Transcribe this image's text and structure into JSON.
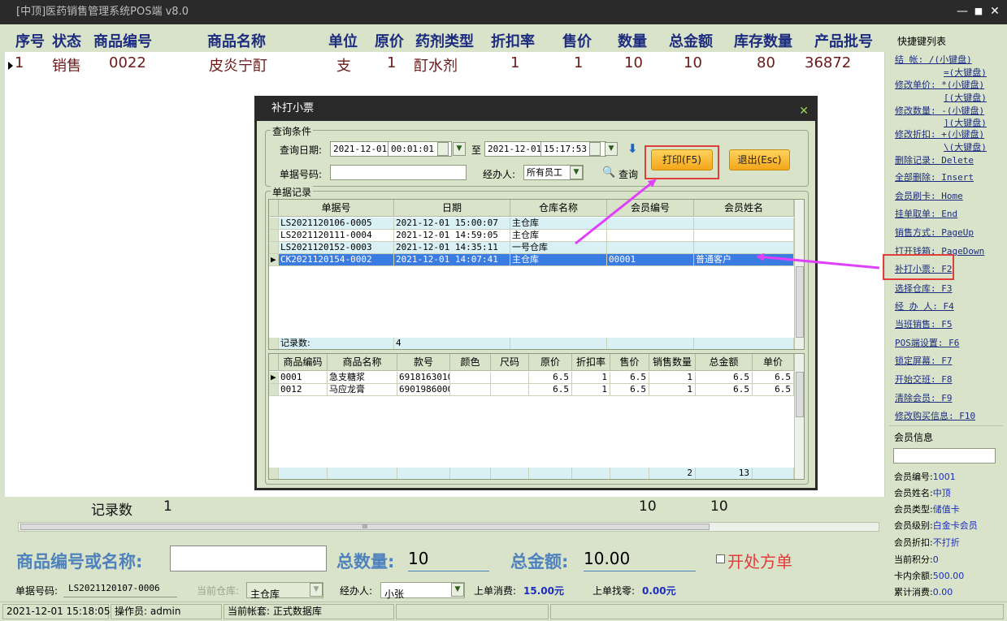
{
  "window": {
    "title": "[中顶]医药销售管理系统POS端 v8.0",
    "min": "—",
    "max": "■",
    "close": "✕"
  },
  "grid": {
    "columns": [
      "序号",
      "状态",
      "商品编号",
      "商品名称",
      "单位",
      "原价",
      "药剂类型",
      "折扣率",
      "售价",
      "数量",
      "总金额",
      "库存数量",
      "产品批号"
    ],
    "rows": [
      {
        "seq": "1",
        "status": "销售",
        "code": "0022",
        "name": "皮炎宁酊",
        "unit": "支",
        "price": "1",
        "type": "酊水剂",
        "discount": "1",
        "sale": "1",
        "qty": "10",
        "total": "10",
        "stock": "80",
        "batch": "36872"
      }
    ],
    "summary": {
      "label": "记录数",
      "count": "1",
      "qty": "10",
      "total": "10"
    },
    "scroll_grip": "III"
  },
  "input_bar": {
    "product_label": "商品编号或名称:",
    "product_value": "",
    "qty_label": "总数量:",
    "qty_value": "10",
    "amount_label": "总金额:",
    "amount_value": "10.00",
    "prescription_label": "开处方单"
  },
  "info_bar": {
    "order_no_label": "单据号码:",
    "order_no": "LS2021120107-0006",
    "warehouse_label": "当前仓库:",
    "warehouse": "主仓库",
    "operator_label": "经办人:",
    "operator": "小张",
    "last_spend_label": "上单消费:",
    "last_spend": "15.00元",
    "last_change_label": "上单找零:",
    "last_change": "0.00元"
  },
  "status_bar": {
    "datetime": "2021-12-01 15:18:05",
    "operator": "操作员: admin",
    "account": "当前帐套: 正式数据库"
  },
  "shortcuts": {
    "title": "快捷键列表",
    "items": [
      "结  帐: /(小键盘)",
      "=(大键盘)",
      "修改单价: *(小键盘)",
      "[(大键盘)",
      "修改数量: -(小键盘)",
      "](大键盘)",
      "修改折扣: +(小键盘)",
      "\\(大键盘)",
      "删除记录: Delete",
      "全部删除: Insert",
      "会员刷卡: Home",
      "挂单取单: End",
      "销售方式: PageUp",
      "打开钱箱: PageDown",
      "补打小票: F2",
      "选择仓库: F3",
      "经 办 人: F4",
      "当班销售: F5",
      "POS端设置: F6",
      "锁定屏幕: F7",
      "开始交班: F8",
      "清除会员: F9",
      "修改购买信息: F10"
    ]
  },
  "member": {
    "title": "会员信息",
    "search": "",
    "fields": [
      {
        "label": "会员编号:",
        "value": "1001"
      },
      {
        "label": "会员姓名:",
        "value": "中顶"
      },
      {
        "label": "会员类型:",
        "value": "储值卡"
      },
      {
        "label": "会员级别:",
        "value": "白金卡会员"
      },
      {
        "label": "会员折扣:",
        "value": "不打折"
      },
      {
        "label": "当前积分:",
        "value": "0"
      },
      {
        "label": "卡内余额:",
        "value": "500.00"
      },
      {
        "label": "累计消费:",
        "value": "0.00"
      }
    ]
  },
  "dialog": {
    "title": "补打小票",
    "close": "✕",
    "query_group": "查询条件",
    "date_label": "查询日期:",
    "date_from": "2021-12-01",
    "time_from": "00:01:01",
    "to_label": "至",
    "date_to": "2021-12-01",
    "time_to": "15:17:53",
    "order_label": "单据号码:",
    "order_value": "",
    "handler_label": "经办人:",
    "handler_value": "所有员工",
    "query_btn": "查询",
    "print_btn": "打印(F5)",
    "exit_btn": "退出(Esc)",
    "records_group": "单据记录",
    "records_cols": [
      "单据号",
      "日期",
      "仓库名称",
      "会员编号",
      "会员姓名"
    ],
    "records": [
      {
        "no": "LS2021120106-0005",
        "date": "2021-12-01 15:00:07",
        "wh": "主仓库",
        "mid": "",
        "mname": ""
      },
      {
        "no": "LS2021120111-0004",
        "date": "2021-12-01 14:59:05",
        "wh": "主仓库",
        "mid": "",
        "mname": ""
      },
      {
        "no": "LS2021120152-0003",
        "date": "2021-12-01 14:35:11",
        "wh": "一号仓库",
        "mid": "",
        "mname": ""
      },
      {
        "no": "CK2021120154-0002",
        "date": "2021-12-01 14:07:41",
        "wh": "主仓库",
        "mid": "00001",
        "mname": "普通客户"
      }
    ],
    "records_footer_label": "记录数:",
    "records_footer_count": "4",
    "detail_cols": [
      "商品编码",
      "商品名称",
      "款号",
      "颜色",
      "尺码",
      "原价",
      "折扣率",
      "售价",
      "销售数量",
      "总金额",
      "单价"
    ],
    "details": [
      {
        "code": "0001",
        "name": "急支糖浆",
        "sku": "6918163010",
        "color": "",
        "size": "",
        "price": "6.5",
        "disc": "1",
        "sale": "6.5",
        "qty": "1",
        "total": "6.5",
        "unit": "6.5"
      },
      {
        "code": "0012",
        "name": "马应龙膏",
        "sku": "6901986000",
        "color": "",
        "size": "",
        "price": "6.5",
        "disc": "1",
        "sale": "6.5",
        "qty": "1",
        "total": "6.5",
        "unit": "6.5"
      }
    ],
    "details_footer_qty": "2",
    "details_footer_total": "13"
  },
  "colors": {
    "accent": "#4f81bd",
    "highlight": "#e23d3d",
    "annotation": "#e040fb",
    "selection": "#3b7ce2"
  }
}
